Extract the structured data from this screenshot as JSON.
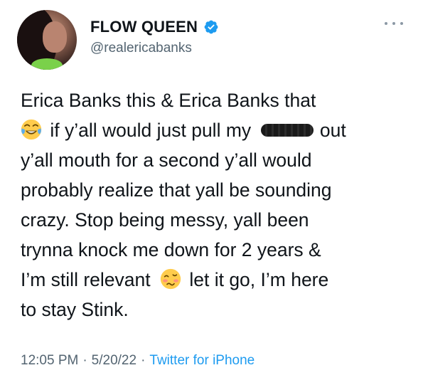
{
  "author": {
    "display_name": "FLOW QUEEN",
    "handle": "@realericabanks",
    "verified_icon": "verified-badge-icon",
    "accent_color": "#1d9bf0"
  },
  "tweet": {
    "lines": [
      {
        "text": "Erica Banks this & Erica Banks that"
      },
      {
        "emoji": "face-with-tears-of-joy-icon",
        "text": "if y’all would just pull my",
        "censored": "censored-word",
        "text_after": "out"
      },
      {
        "text": "y’all mouth for a second y’all would"
      },
      {
        "text": "probably realize that yall be sounding"
      },
      {
        "text": "crazy. Stop being messy, yall been"
      },
      {
        "text": "trynna knock me down for 2 years &"
      },
      {
        "text_before": "I’m still relevant",
        "emoji": "woozy-face-icon",
        "text_after": "let it go, I’m here"
      },
      {
        "text": "to stay Stink."
      }
    ]
  },
  "meta": {
    "time": "12:05 PM",
    "date": "5/20/22",
    "source": "Twitter for iPhone",
    "separator": "·"
  },
  "colors": {
    "text": "#0f1419",
    "secondary": "#536471",
    "link": "#1d9bf0"
  }
}
